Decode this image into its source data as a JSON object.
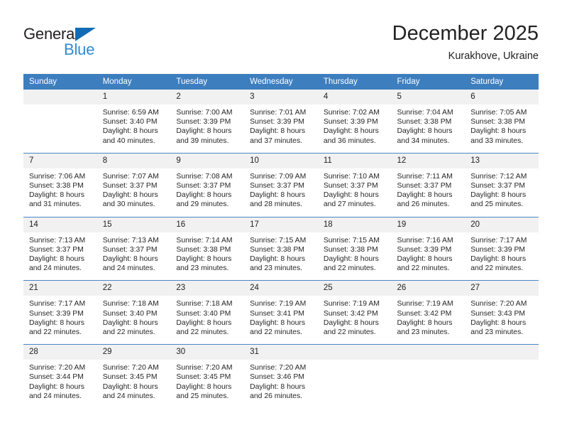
{
  "brand": {
    "name_top": "General",
    "name_bottom": "Blue",
    "triangle_color": "#0f6cb5",
    "text_color_top": "#231f20",
    "text_color_bottom": "#2e8bd4"
  },
  "header": {
    "title": "December 2025",
    "subtitle": "Kurakhove, Ukraine"
  },
  "theme": {
    "header_bg": "#3d7ebf",
    "header_text": "#ffffff",
    "daynum_bg": "#f1f1f1",
    "cell_bg": "#ffffff",
    "row_divider": "#4a86c5"
  },
  "columns": [
    "Sunday",
    "Monday",
    "Tuesday",
    "Wednesday",
    "Thursday",
    "Friday",
    "Saturday"
  ],
  "weeks": [
    [
      {
        "day": "",
        "blank": true,
        "lines": []
      },
      {
        "day": "1",
        "blank": false,
        "lines": [
          "Sunrise: 6:59 AM",
          "Sunset: 3:40 PM",
          "Daylight: 8 hours",
          "and 40 minutes."
        ]
      },
      {
        "day": "2",
        "blank": false,
        "lines": [
          "Sunrise: 7:00 AM",
          "Sunset: 3:39 PM",
          "Daylight: 8 hours",
          "and 39 minutes."
        ]
      },
      {
        "day": "3",
        "blank": false,
        "lines": [
          "Sunrise: 7:01 AM",
          "Sunset: 3:39 PM",
          "Daylight: 8 hours",
          "and 37 minutes."
        ]
      },
      {
        "day": "4",
        "blank": false,
        "lines": [
          "Sunrise: 7:02 AM",
          "Sunset: 3:39 PM",
          "Daylight: 8 hours",
          "and 36 minutes."
        ]
      },
      {
        "day": "5",
        "blank": false,
        "lines": [
          "Sunrise: 7:04 AM",
          "Sunset: 3:38 PM",
          "Daylight: 8 hours",
          "and 34 minutes."
        ]
      },
      {
        "day": "6",
        "blank": false,
        "lines": [
          "Sunrise: 7:05 AM",
          "Sunset: 3:38 PM",
          "Daylight: 8 hours",
          "and 33 minutes."
        ]
      }
    ],
    [
      {
        "day": "7",
        "blank": false,
        "lines": [
          "Sunrise: 7:06 AM",
          "Sunset: 3:38 PM",
          "Daylight: 8 hours",
          "and 31 minutes."
        ]
      },
      {
        "day": "8",
        "blank": false,
        "lines": [
          "Sunrise: 7:07 AM",
          "Sunset: 3:37 PM",
          "Daylight: 8 hours",
          "and 30 minutes."
        ]
      },
      {
        "day": "9",
        "blank": false,
        "lines": [
          "Sunrise: 7:08 AM",
          "Sunset: 3:37 PM",
          "Daylight: 8 hours",
          "and 29 minutes."
        ]
      },
      {
        "day": "10",
        "blank": false,
        "lines": [
          "Sunrise: 7:09 AM",
          "Sunset: 3:37 PM",
          "Daylight: 8 hours",
          "and 28 minutes."
        ]
      },
      {
        "day": "11",
        "blank": false,
        "lines": [
          "Sunrise: 7:10 AM",
          "Sunset: 3:37 PM",
          "Daylight: 8 hours",
          "and 27 minutes."
        ]
      },
      {
        "day": "12",
        "blank": false,
        "lines": [
          "Sunrise: 7:11 AM",
          "Sunset: 3:37 PM",
          "Daylight: 8 hours",
          "and 26 minutes."
        ]
      },
      {
        "day": "13",
        "blank": false,
        "lines": [
          "Sunrise: 7:12 AM",
          "Sunset: 3:37 PM",
          "Daylight: 8 hours",
          "and 25 minutes."
        ]
      }
    ],
    [
      {
        "day": "14",
        "blank": false,
        "lines": [
          "Sunrise: 7:13 AM",
          "Sunset: 3:37 PM",
          "Daylight: 8 hours",
          "and 24 minutes."
        ]
      },
      {
        "day": "15",
        "blank": false,
        "lines": [
          "Sunrise: 7:13 AM",
          "Sunset: 3:37 PM",
          "Daylight: 8 hours",
          "and 24 minutes."
        ]
      },
      {
        "day": "16",
        "blank": false,
        "lines": [
          "Sunrise: 7:14 AM",
          "Sunset: 3:38 PM",
          "Daylight: 8 hours",
          "and 23 minutes."
        ]
      },
      {
        "day": "17",
        "blank": false,
        "lines": [
          "Sunrise: 7:15 AM",
          "Sunset: 3:38 PM",
          "Daylight: 8 hours",
          "and 23 minutes."
        ]
      },
      {
        "day": "18",
        "blank": false,
        "lines": [
          "Sunrise: 7:15 AM",
          "Sunset: 3:38 PM",
          "Daylight: 8 hours",
          "and 22 minutes."
        ]
      },
      {
        "day": "19",
        "blank": false,
        "lines": [
          "Sunrise: 7:16 AM",
          "Sunset: 3:39 PM",
          "Daylight: 8 hours",
          "and 22 minutes."
        ]
      },
      {
        "day": "20",
        "blank": false,
        "lines": [
          "Sunrise: 7:17 AM",
          "Sunset: 3:39 PM",
          "Daylight: 8 hours",
          "and 22 minutes."
        ]
      }
    ],
    [
      {
        "day": "21",
        "blank": false,
        "lines": [
          "Sunrise: 7:17 AM",
          "Sunset: 3:39 PM",
          "Daylight: 8 hours",
          "and 22 minutes."
        ]
      },
      {
        "day": "22",
        "blank": false,
        "lines": [
          "Sunrise: 7:18 AM",
          "Sunset: 3:40 PM",
          "Daylight: 8 hours",
          "and 22 minutes."
        ]
      },
      {
        "day": "23",
        "blank": false,
        "lines": [
          "Sunrise: 7:18 AM",
          "Sunset: 3:40 PM",
          "Daylight: 8 hours",
          "and 22 minutes."
        ]
      },
      {
        "day": "24",
        "blank": false,
        "lines": [
          "Sunrise: 7:19 AM",
          "Sunset: 3:41 PM",
          "Daylight: 8 hours",
          "and 22 minutes."
        ]
      },
      {
        "day": "25",
        "blank": false,
        "lines": [
          "Sunrise: 7:19 AM",
          "Sunset: 3:42 PM",
          "Daylight: 8 hours",
          "and 22 minutes."
        ]
      },
      {
        "day": "26",
        "blank": false,
        "lines": [
          "Sunrise: 7:19 AM",
          "Sunset: 3:42 PM",
          "Daylight: 8 hours",
          "and 23 minutes."
        ]
      },
      {
        "day": "27",
        "blank": false,
        "lines": [
          "Sunrise: 7:20 AM",
          "Sunset: 3:43 PM",
          "Daylight: 8 hours",
          "and 23 minutes."
        ]
      }
    ],
    [
      {
        "day": "28",
        "blank": false,
        "lines": [
          "Sunrise: 7:20 AM",
          "Sunset: 3:44 PM",
          "Daylight: 8 hours",
          "and 24 minutes."
        ]
      },
      {
        "day": "29",
        "blank": false,
        "lines": [
          "Sunrise: 7:20 AM",
          "Sunset: 3:45 PM",
          "Daylight: 8 hours",
          "and 24 minutes."
        ]
      },
      {
        "day": "30",
        "blank": false,
        "lines": [
          "Sunrise: 7:20 AM",
          "Sunset: 3:45 PM",
          "Daylight: 8 hours",
          "and 25 minutes."
        ]
      },
      {
        "day": "31",
        "blank": false,
        "lines": [
          "Sunrise: 7:20 AM",
          "Sunset: 3:46 PM",
          "Daylight: 8 hours",
          "and 26 minutes."
        ]
      },
      {
        "day": "",
        "blank": true,
        "lines": []
      },
      {
        "day": "",
        "blank": true,
        "lines": []
      },
      {
        "day": "",
        "blank": true,
        "lines": []
      }
    ]
  ]
}
